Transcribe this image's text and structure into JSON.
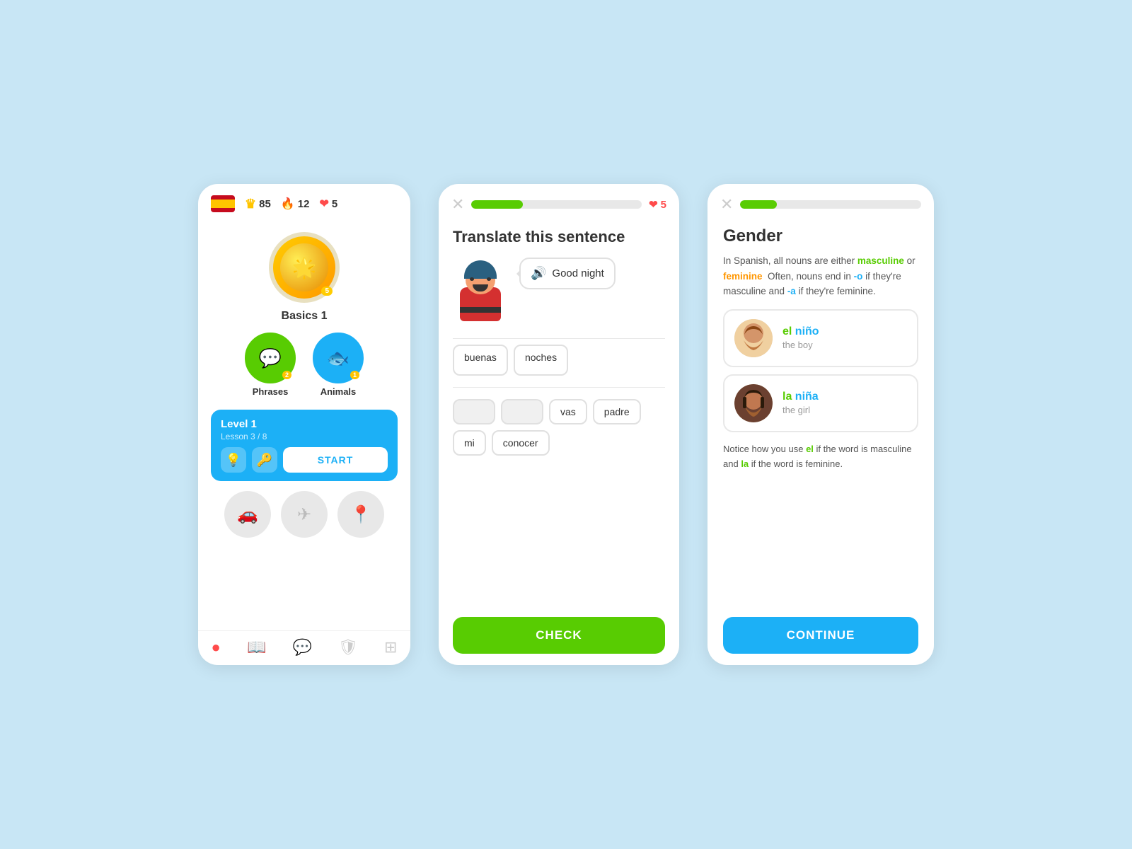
{
  "background": "#c8e6f5",
  "card1": {
    "flag": "es",
    "stats": {
      "crown_value": "85",
      "fire_value": "12",
      "heart_value": "5"
    },
    "basics": {
      "name": "Basics 1",
      "badge": "5"
    },
    "lessons": [
      {
        "name": "Phrases",
        "badge": "2",
        "color": "green"
      },
      {
        "name": "Animals",
        "badge": "1",
        "color": "blue"
      }
    ],
    "level": {
      "title": "Level 1",
      "sub": "Lesson 3 / 8",
      "start_label": "START"
    },
    "nav_items": [
      "home",
      "book",
      "chat",
      "shield",
      "grid"
    ]
  },
  "card2": {
    "progress": 30,
    "hearts": "5",
    "title": "Translate this sentence",
    "speech_text": "Good night",
    "answer_slots": [
      "buenas",
      "noches"
    ],
    "word_options": [
      {
        "text": "",
        "selected": true
      },
      {
        "text": "",
        "selected": true
      },
      {
        "text": "vas",
        "selected": false
      },
      {
        "text": "padre",
        "selected": false
      },
      {
        "text": "mi",
        "selected": false
      },
      {
        "text": "conocer",
        "selected": false
      }
    ],
    "check_label": "CHECK"
  },
  "card3": {
    "progress": 20,
    "title": "Gender",
    "description_parts": [
      "In Spanish, all nouns are either ",
      "masculine",
      " or ",
      "feminine",
      "  Often, nouns end in ",
      "-o",
      " if they're masculine and ",
      "-a",
      " if they're feminine."
    ],
    "examples": [
      {
        "article": "el",
        "word": " niño",
        "translation": "the boy",
        "gender": "boy"
      },
      {
        "article": "la",
        "word": " niña",
        "translation": "the girl",
        "gender": "girl"
      }
    ],
    "notice": "Notice how you use ",
    "notice_el": "el",
    "notice_mid": " if the word is masculine and ",
    "notice_la": "la",
    "notice_end": " if the word is feminine.",
    "continue_label": "CONTINUE"
  }
}
